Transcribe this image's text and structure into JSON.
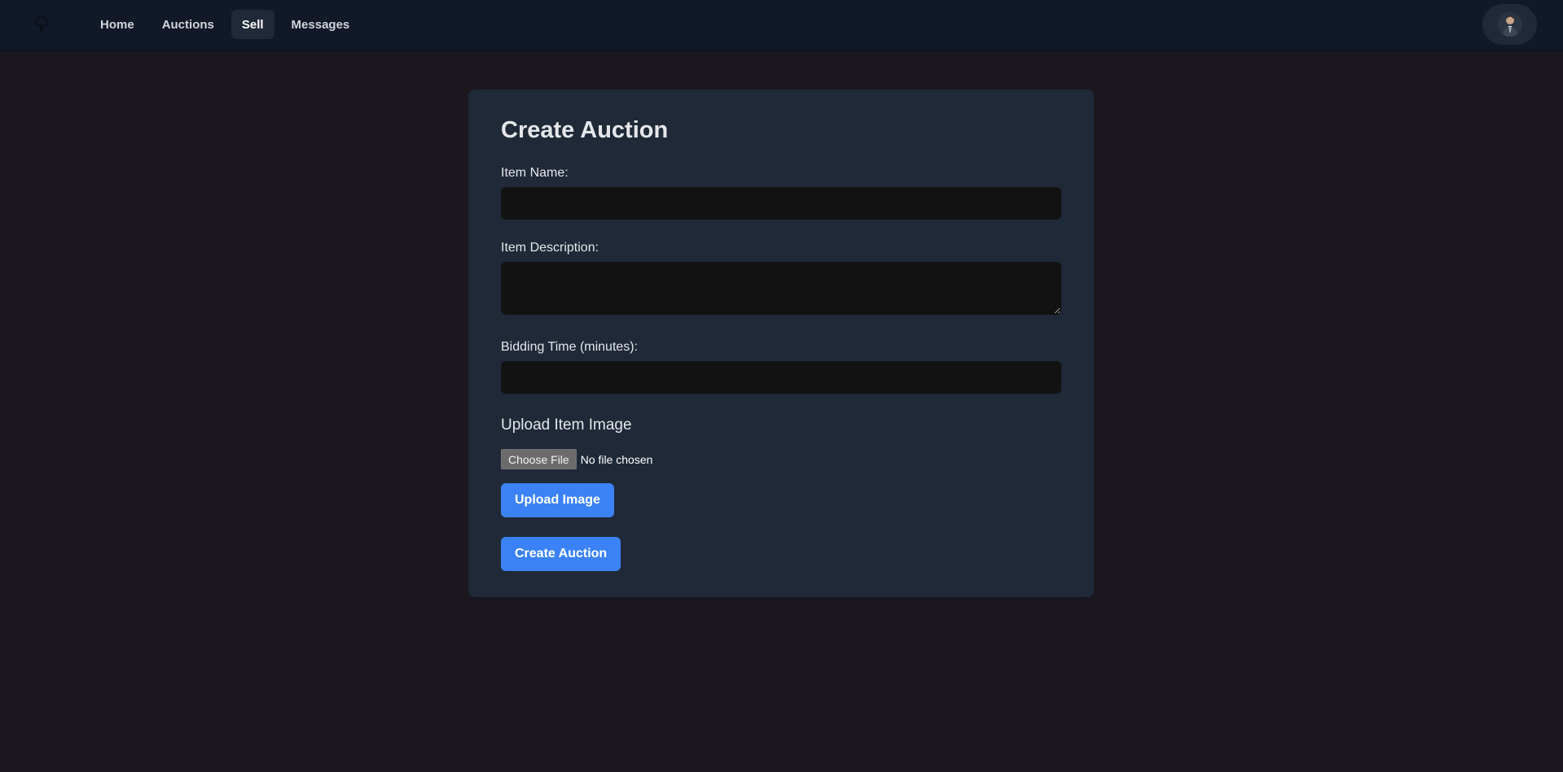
{
  "nav": {
    "logo_icon": "tree-logo-icon",
    "links": [
      {
        "label": "Home"
      },
      {
        "label": "Auctions"
      },
      {
        "label": "Sell"
      },
      {
        "label": "Messages"
      }
    ],
    "active": "Sell",
    "avatar_icon": "user-avatar"
  },
  "form": {
    "title": "Create Auction",
    "item_name_label": "Item Name:",
    "item_name_value": "",
    "item_description_label": "Item Description:",
    "item_description_value": "",
    "bidding_time_label": "Bidding Time (minutes):",
    "bidding_time_value": "",
    "upload_heading": "Upload Item Image",
    "choose_file_label": "Choose File",
    "file_status": "No file chosen",
    "upload_button_label": "Upload Image",
    "submit_button_label": "Create Auction"
  },
  "colors": {
    "page_bg": "#1a171e",
    "navbar_bg": "#111827",
    "card_bg": "#1f2937",
    "input_bg": "#121212",
    "accent": "#3b82f6"
  }
}
